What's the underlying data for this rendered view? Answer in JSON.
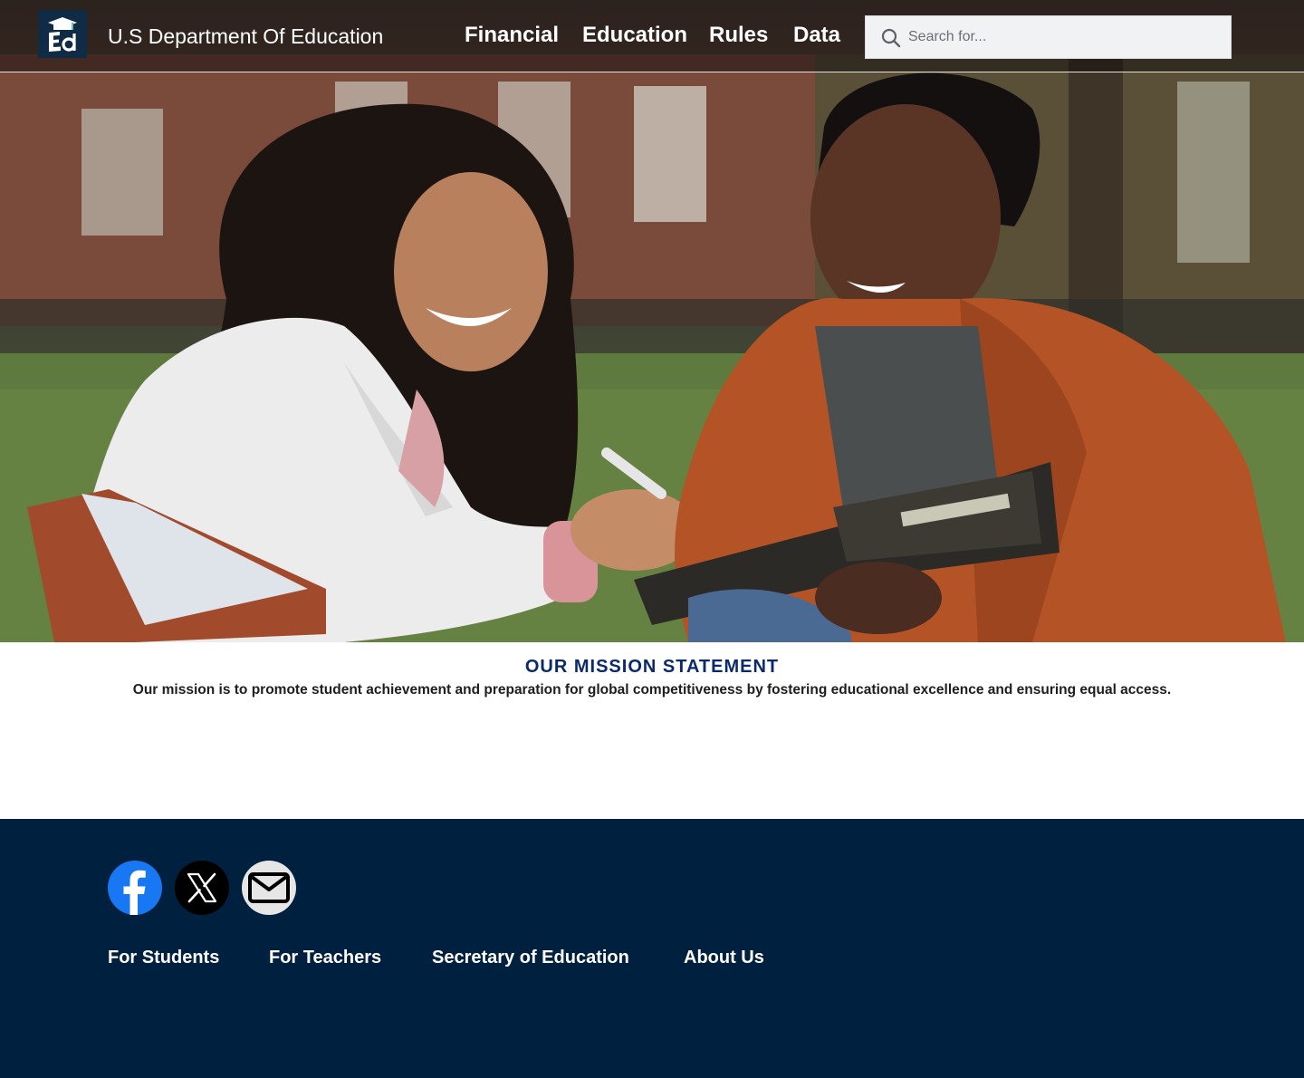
{
  "header": {
    "logo_icon": "ed-graduation-cap-logo",
    "site_title": "U.S Department Of Education",
    "nav": [
      {
        "label": "Financial"
      },
      {
        "label": "Education"
      },
      {
        "label": "Rules"
      },
      {
        "label": "Data"
      }
    ],
    "search": {
      "placeholder": "Search for...",
      "value": "",
      "icon": "search-icon"
    }
  },
  "hero": {
    "image": "two-students-studying-outdoors-photo"
  },
  "mission": {
    "title": "OUR MISSION STATEMENT",
    "text": "Our mission is to promote student achievement and preparation for global competitiveness by fostering educational excellence and ensuring equal access."
  },
  "footer": {
    "social": [
      {
        "icon": "facebook-icon",
        "color": "#1877f2"
      },
      {
        "icon": "x-twitter-icon",
        "color": "#000000"
      },
      {
        "icon": "email-icon",
        "color": "#e6e6e6"
      }
    ],
    "links": [
      {
        "label": "For Students"
      },
      {
        "label": "For Teachers"
      },
      {
        "label": "Secretary of Education"
      },
      {
        "label": "About Us"
      }
    ]
  },
  "colors": {
    "footer_bg": "#00203f",
    "mission_title": "#0a2a6b",
    "logo_bg": "#0f2b46"
  }
}
